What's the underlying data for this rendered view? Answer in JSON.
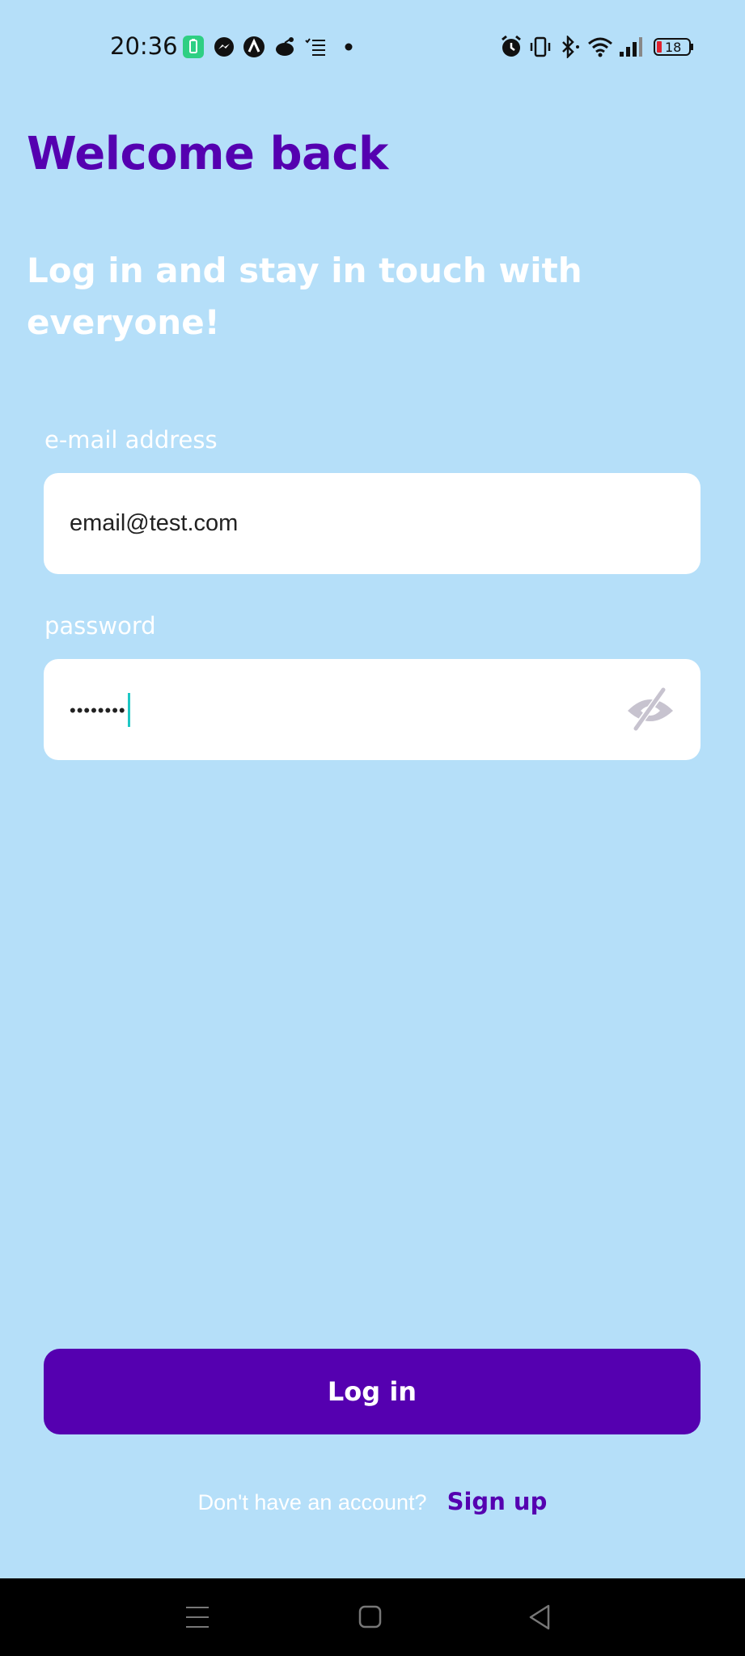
{
  "status_bar": {
    "time": "20:36",
    "battery_level": "18",
    "icons": [
      "battery-saver-icon",
      "messenger-icon",
      "app-icon",
      "reddit-icon",
      "checklist-icon",
      "dot-icon",
      "alarm-icon",
      "vibrate-icon",
      "bluetooth-icon",
      "wifi-icon",
      "signal-icon",
      "battery-icon"
    ]
  },
  "header": {
    "title": "Welcome back",
    "subtitle": "Log in and stay in touch with everyone!"
  },
  "form": {
    "email_label": "e-mail address",
    "email_value": "email@test.com",
    "password_label": "password",
    "password_value": "••••••••",
    "password_visibility_icon": "eye-off-icon"
  },
  "actions": {
    "login_label": "Log in",
    "signup_prompt": "Don't have an account?",
    "signup_label": "Sign up"
  },
  "navigation": {
    "icons": [
      "menu-icon",
      "home-icon",
      "back-icon"
    ]
  },
  "colors": {
    "background": "#b5dff9",
    "accent": "#5500b0",
    "caret": "#1ec7c4"
  }
}
